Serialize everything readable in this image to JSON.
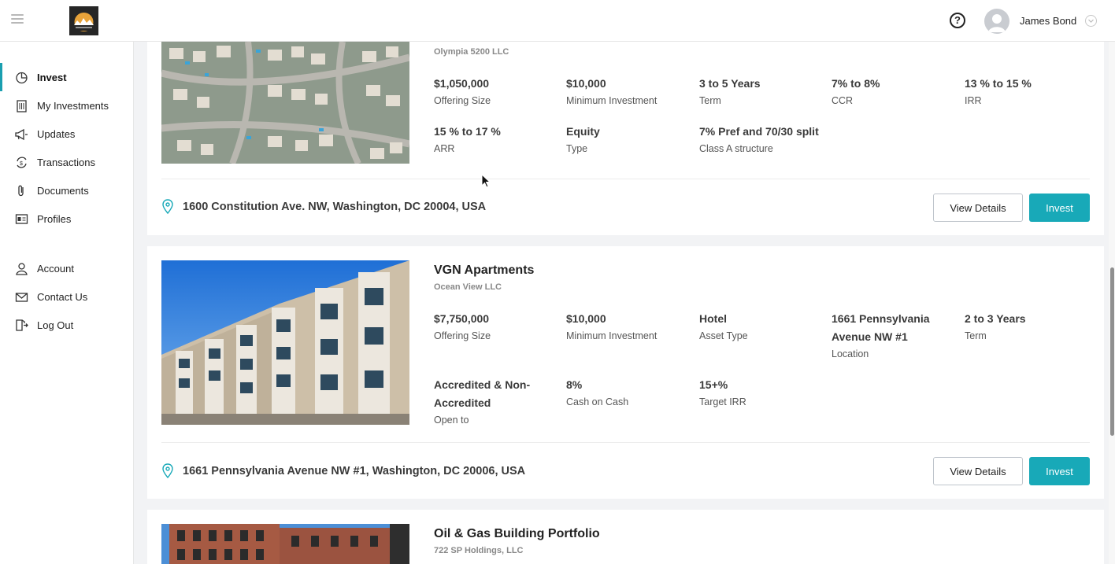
{
  "header": {
    "user_name": "James Bond",
    "help_label": "?"
  },
  "sidebar": {
    "items": [
      {
        "label": "Invest",
        "icon": "pie-chart-icon"
      },
      {
        "label": "My Investments",
        "icon": "building-icon"
      },
      {
        "label": "Updates",
        "icon": "megaphone-icon"
      },
      {
        "label": "Transactions",
        "icon": "exchange-icon"
      },
      {
        "label": "Documents",
        "icon": "paperclip-icon"
      },
      {
        "label": "Profiles",
        "icon": "id-card-icon"
      },
      {
        "label": "Account",
        "icon": "user-icon"
      },
      {
        "label": "Contact Us",
        "icon": "envelope-icon"
      },
      {
        "label": "Log Out",
        "icon": "logout-icon"
      }
    ]
  },
  "offerings": [
    {
      "sponsor": "Olympia 5200 LLC",
      "metrics": [
        {
          "value": "$1,050,000",
          "label": "Offering Size"
        },
        {
          "value": "$10,000",
          "label": "Minimum Investment"
        },
        {
          "value": "3 to 5 Years",
          "label": "Term"
        },
        {
          "value": "7% to 8%",
          "label": "CCR"
        },
        {
          "value": "13 % to 15 %",
          "label": "IRR"
        },
        {
          "value": "15 % to 17 %",
          "label": "ARR"
        },
        {
          "value": "Equity",
          "label": "Type"
        },
        {
          "value": "7% Pref and 70/30 split",
          "label": "Class A structure"
        }
      ],
      "address": "1600 Constitution Ave. NW, Washington, DC 20004, USA",
      "details_label": "View Details",
      "invest_label": "Invest"
    },
    {
      "title": "VGN Apartments",
      "sponsor": "Ocean View LLC",
      "metrics": [
        {
          "value": "$7,750,000",
          "label": "Offering Size"
        },
        {
          "value": "$10,000",
          "label": "Minimum Investment"
        },
        {
          "value": "Hotel",
          "label": "Asset Type"
        },
        {
          "value": "1661 Pennsylvania Avenue NW #1",
          "label": "Location"
        },
        {
          "value": "2 to 3 Years",
          "label": "Term"
        },
        {
          "value": "Accredited & Non-Accredited",
          "label": "Open to"
        },
        {
          "value": "8%",
          "label": "Cash on Cash"
        },
        {
          "value": "15+%",
          "label": "Target IRR"
        }
      ],
      "address": "1661 Pennsylvania Avenue NW #1, Washington, DC 20006, USA",
      "details_label": "View Details",
      "invest_label": "Invest"
    },
    {
      "title": "Oil & Gas Building Portfolio",
      "sponsor": "722 SP Holdings, LLC"
    }
  ]
}
